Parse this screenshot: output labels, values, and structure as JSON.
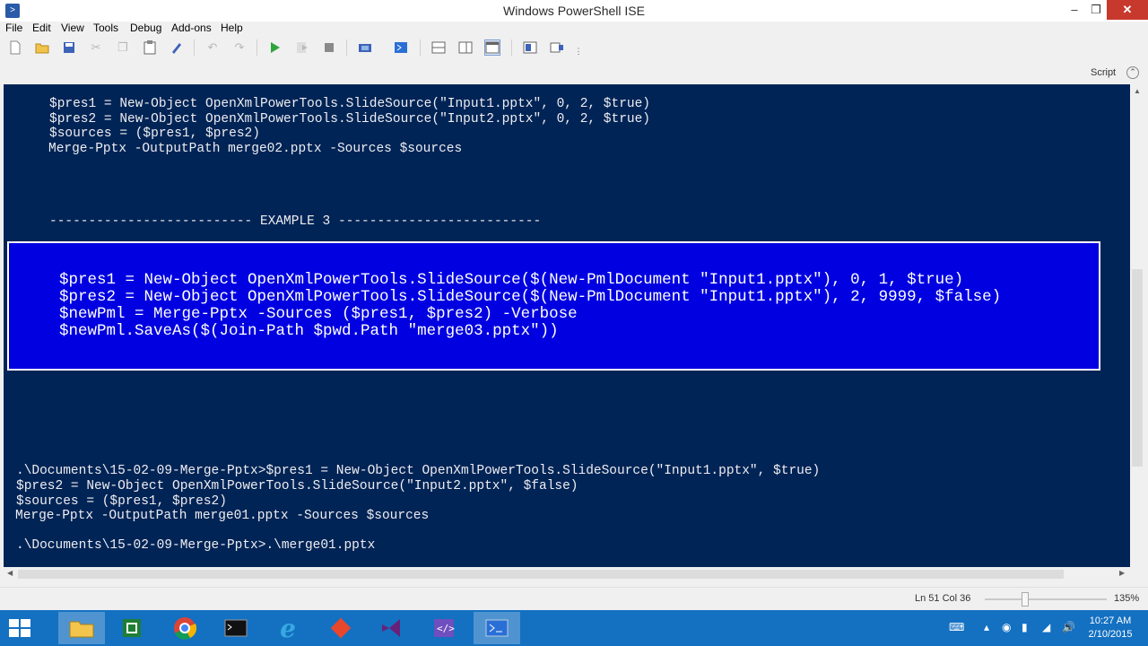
{
  "window": {
    "title": "Windows PowerShell ISE"
  },
  "menu": [
    "File",
    "Edit",
    "View",
    "Tools",
    "Debug",
    "Add-ons",
    "Help"
  ],
  "toolbar": {
    "icons": [
      "new-icon",
      "open-icon",
      "save-icon",
      "cut-icon",
      "copy-icon",
      "paste-icon",
      "clear-icon",
      "undo-icon",
      "redo-icon",
      "run-icon",
      "run-selection-icon",
      "stop-icon",
      "remote-icon",
      "powershell-icon",
      "layout-top-icon",
      "layout-right-icon",
      "layout-max-icon",
      "commands-icon",
      "addon-icon"
    ]
  },
  "script_pane": {
    "label": "Script"
  },
  "console": {
    "upper_lines": [
      "$pres1 = New-Object OpenXmlPowerTools.SlideSource(\"Input1.pptx\", 0, 2, $true)",
      "$pres2 = New-Object OpenXmlPowerTools.SlideSource(\"Input2.pptx\", 0, 2, $true)",
      "$sources = ($pres1, $pres2)",
      "Merge-Pptx -OutputPath merge02.pptx -Sources $sources"
    ],
    "example_header": "-------------------------- EXAMPLE 3 --------------------------",
    "selected_lines": [
      "$pres1 = New-Object OpenXmlPowerTools.SlideSource($(New-PmlDocument \"Input1.pptx\"), 0, 1, $true)",
      "$pres2 = New-Object OpenXmlPowerTools.SlideSource($(New-PmlDocument \"Input1.pptx\"), 2, 9999, $false)",
      "$newPml = Merge-Pptx -Sources ($pres1, $pres2) -Verbose",
      "$newPml.SaveAs($(Join-Path $pwd.Path \"merge03.pptx\"))"
    ],
    "prompt_lines": [
      ".\\Documents\\15-02-09-Merge-Pptx>$pres1 = New-Object OpenXmlPowerTools.SlideSource(\"Input1.pptx\", $true)",
      "$pres2 = New-Object OpenXmlPowerTools.SlideSource(\"Input2.pptx\", $false)",
      "$sources = ($pres1, $pres2)",
      "Merge-Pptx -OutputPath merge01.pptx -Sources $sources"
    ],
    "last_prompt": ".\\Documents\\15-02-09-Merge-Pptx>.\\merge01.pptx"
  },
  "status": {
    "position": "Ln 51  Col 36",
    "zoom": "135%"
  },
  "taskbar": {
    "apps": [
      "file-explorer",
      "excel",
      "chrome",
      "cmd",
      "internet-explorer",
      "git",
      "visual-studio",
      "xml-editor",
      "powershell"
    ],
    "clock_time": "10:27 AM",
    "clock_date": "2/10/2015"
  }
}
